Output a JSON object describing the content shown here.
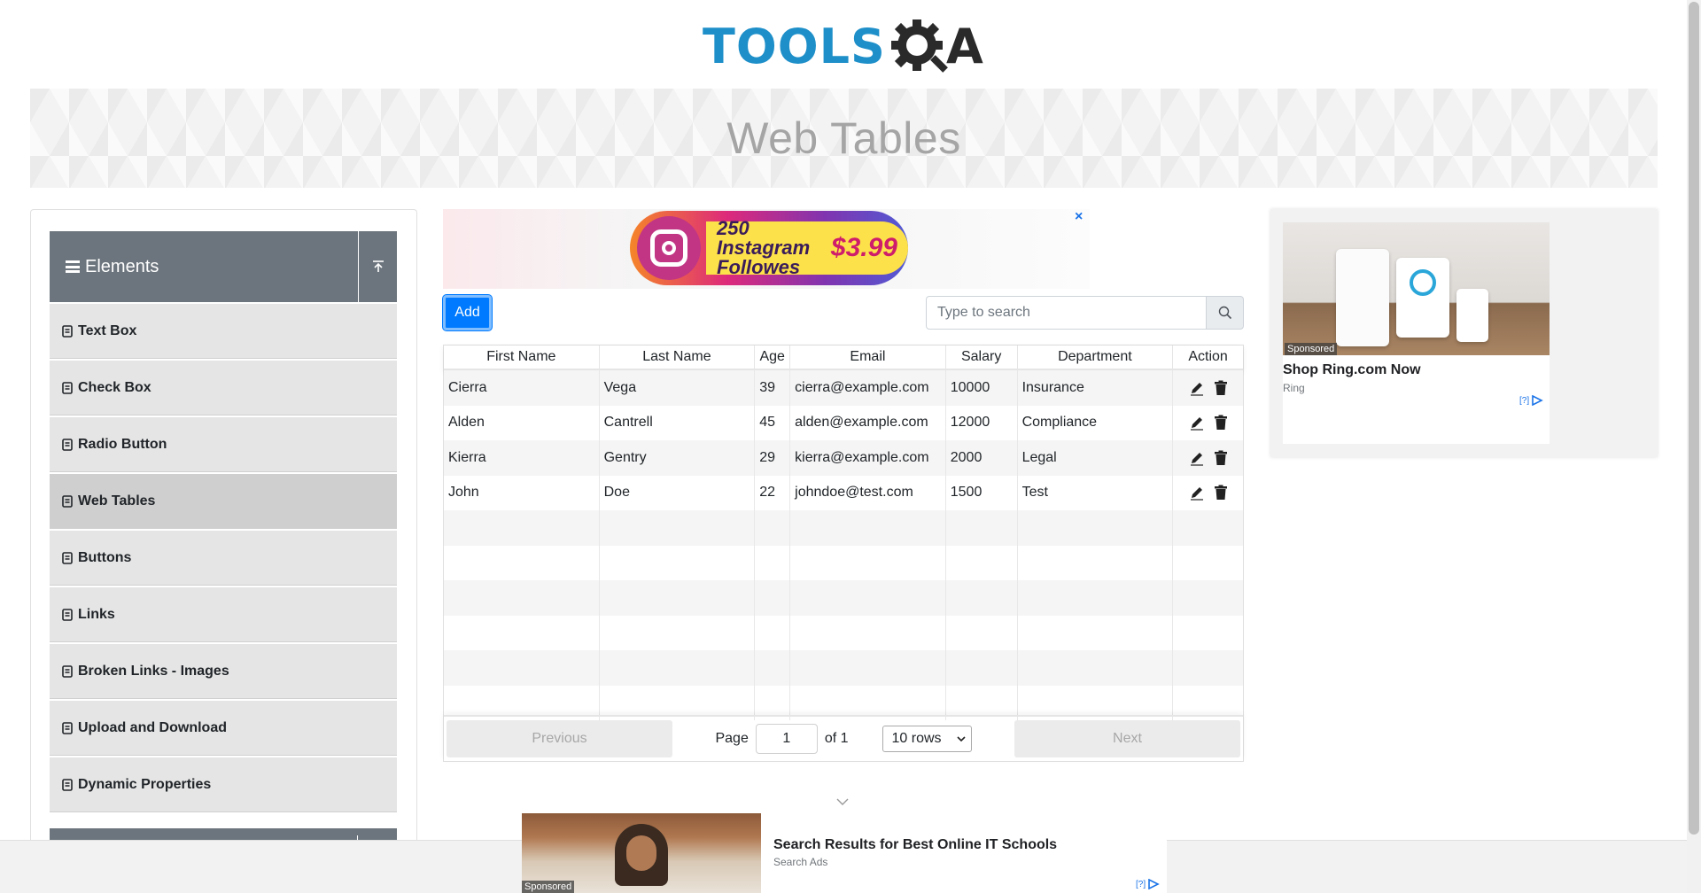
{
  "logo": {
    "text": "TOOLS",
    "suffix": "A"
  },
  "banner": {
    "title": "Web Tables"
  },
  "sidebar": {
    "group": "Elements",
    "items": [
      {
        "label": "Text Box",
        "active": false
      },
      {
        "label": "Check Box",
        "active": false
      },
      {
        "label": "Radio Button",
        "active": false
      },
      {
        "label": "Web Tables",
        "active": true
      },
      {
        "label": "Buttons",
        "active": false
      },
      {
        "label": "Links",
        "active": false
      },
      {
        "label": "Broken Links - Images",
        "active": false
      },
      {
        "label": "Upload and Download",
        "active": false
      },
      {
        "label": "Dynamic Properties",
        "active": false
      }
    ]
  },
  "ad_top": {
    "line1": "250 Instagram",
    "line2": "Followes",
    "price": "$3.99",
    "close": "×"
  },
  "toolbar": {
    "add_label": "Add",
    "search_placeholder": "Type to search"
  },
  "table": {
    "columns": [
      "First Name",
      "Last Name",
      "Age",
      "Email",
      "Salary",
      "Department",
      "Action"
    ],
    "rows": [
      [
        "Cierra",
        "Vega",
        "39",
        "cierra@example.com",
        "10000",
        "Insurance"
      ],
      [
        "Alden",
        "Cantrell",
        "45",
        "alden@example.com",
        "12000",
        "Compliance"
      ],
      [
        "Kierra",
        "Gentry",
        "29",
        "kierra@example.com",
        "2000",
        "Legal"
      ],
      [
        "John",
        "Doe",
        "22",
        "johndoe@test.com",
        "1500",
        "Test"
      ]
    ],
    "empty_rows": 6
  },
  "pagination": {
    "previous": "Previous",
    "page_label": "Page",
    "page_value": "1",
    "of_label": "of 1",
    "rows_select": "10 rows",
    "next": "Next"
  },
  "ad_right": {
    "sponsored": "Sponsored",
    "title": "Shop Ring.com Now",
    "advertiser": "Ring",
    "adchoice": "[?]"
  },
  "ad_bottom": {
    "sponsored": "Sponsored",
    "title": "Search Results for Best Online IT Schools",
    "advertiser": "Search Ads",
    "adchoice": "[?]"
  },
  "colors": {
    "brand_blue": "#1e8fc9",
    "primary": "#007bff",
    "header_gray": "#6c757d"
  }
}
